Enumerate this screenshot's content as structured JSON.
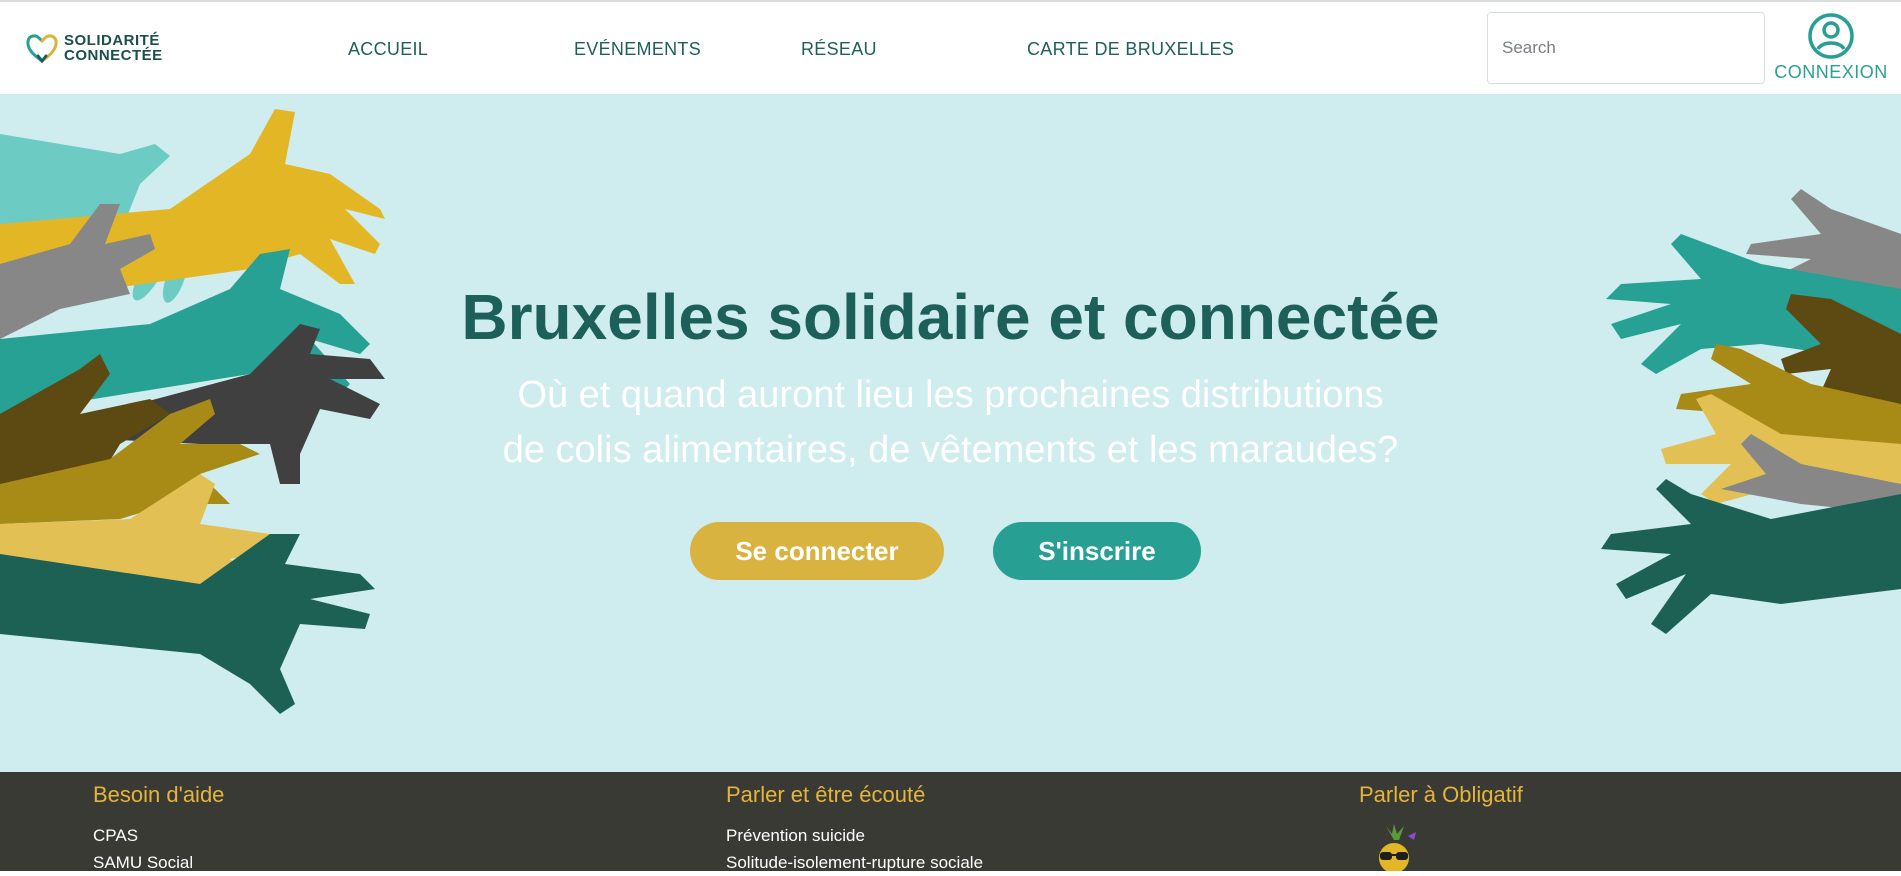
{
  "brand": {
    "line1": "SOLIDARITÉ",
    "line2": "CONNECTÉE"
  },
  "nav": {
    "links": [
      {
        "label": "ACCUEIL"
      },
      {
        "label": "EVÉNEMENTS"
      },
      {
        "label": "RÉSEAU"
      },
      {
        "label": "CARTE DE BRUXELLES"
      }
    ],
    "search_placeholder": "Search",
    "login_label": "CONNEXION"
  },
  "hero": {
    "title": "Bruxelles solidaire et connectée",
    "subtitle_line1": "Où et quand auront lieu les prochaines distributions",
    "subtitle_line2": "de colis alimentaires, de vêtements et les maraudes?",
    "button_login": "Se connecter",
    "button_signup": "S'inscrire"
  },
  "footer": {
    "columns": [
      {
        "title": "Besoin d'aide",
        "items": [
          "CPAS",
          "SAMU Social"
        ]
      },
      {
        "title": "Parler et être écouté",
        "items": [
          "Prévention suicide",
          "Solitude-isolement-rupture sociale"
        ]
      },
      {
        "title": "Parler à Obligatif",
        "items": []
      }
    ]
  },
  "colors": {
    "brand_dark": "#1d5f59",
    "accent_teal": "#27a093",
    "accent_gold": "#d8b33f",
    "hero_bg": "#cfecee",
    "footer_bg": "#3a3a35",
    "footer_title": "#e5b43a"
  }
}
